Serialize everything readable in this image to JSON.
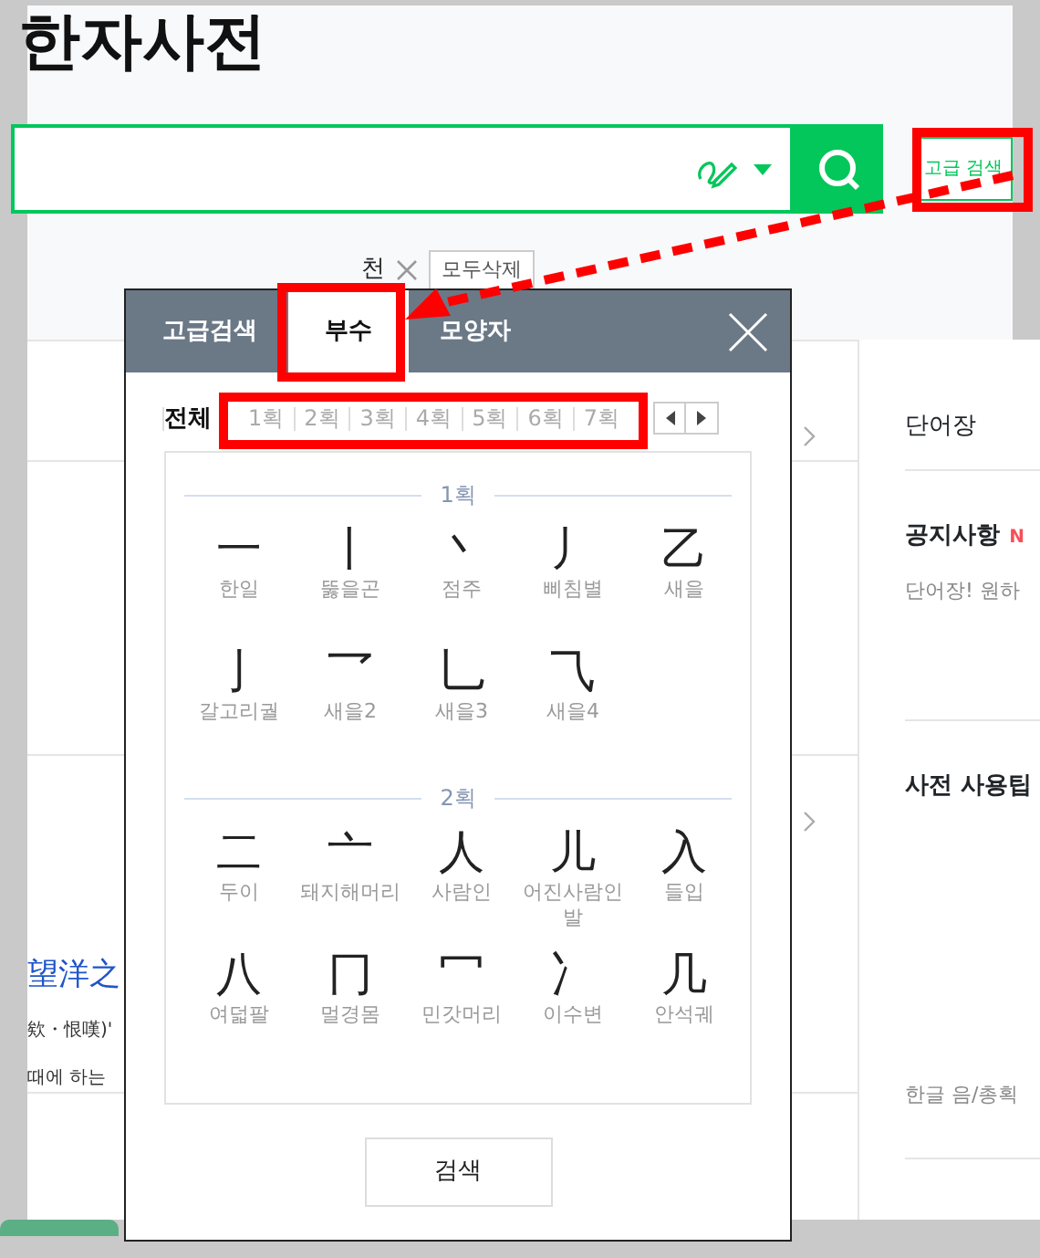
{
  "title": "한자사전",
  "search": {
    "advanced_button": "고급 검색"
  },
  "recent": {
    "items": [
      "천"
    ],
    "clear_all": "모두삭제"
  },
  "left_texts": [
    {
      "kind": "link",
      "text": "望洋之"
    },
    {
      "kind": "plain",
      "text": "欸・恨嘆)'"
    },
    {
      "kind": "plain",
      "text": "때에 하는"
    }
  ],
  "right_panel": {
    "tab": "단어장",
    "notice_title": "공지사항",
    "notice_badge": "N",
    "notice_text": "단어장! 원하",
    "tips_title": "사전 사용팁",
    "tips_text": "한글 음/총획"
  },
  "popup": {
    "tabs": [
      {
        "label": "고급검색",
        "selected": false
      },
      {
        "label": "부수",
        "selected": true
      },
      {
        "label": "모양자",
        "selected": false
      }
    ],
    "filters": [
      {
        "label": "전체",
        "selected": true
      },
      {
        "label": "1획",
        "selected": false
      },
      {
        "label": "2획",
        "selected": false
      },
      {
        "label": "3획",
        "selected": false
      },
      {
        "label": "4획",
        "selected": false
      },
      {
        "label": "5획",
        "selected": false
      },
      {
        "label": "6획",
        "selected": false
      },
      {
        "label": "7획",
        "selected": false
      }
    ],
    "sections": [
      {
        "heading": "1획",
        "items": [
          {
            "glyph": "一",
            "name": "한일"
          },
          {
            "glyph": "丨",
            "name": "뚫을곤"
          },
          {
            "glyph": "丶",
            "name": "점주"
          },
          {
            "glyph": "丿",
            "name": "삐침별"
          },
          {
            "glyph": "乙",
            "name": "새을"
          },
          {
            "glyph": "亅",
            "name": "갈고리궐"
          },
          {
            "glyph": "乛",
            "name": "새을2"
          },
          {
            "glyph": "乚",
            "name": "새을3"
          },
          {
            "glyph": "⺄",
            "name": "새을4"
          }
        ]
      },
      {
        "heading": "2획",
        "items": [
          {
            "glyph": "二",
            "name": "두이"
          },
          {
            "glyph": "亠",
            "name": "돼지해머리"
          },
          {
            "glyph": "人",
            "name": "사람인"
          },
          {
            "glyph": "儿",
            "name": "어진사람인발"
          },
          {
            "glyph": "入",
            "name": "들입"
          },
          {
            "glyph": "八",
            "name": "여덟팔"
          },
          {
            "glyph": "冂",
            "name": "멀경몸"
          },
          {
            "glyph": "冖",
            "name": "민갓머리"
          },
          {
            "glyph": "冫",
            "name": "이수변"
          },
          {
            "glyph": "几",
            "name": "안석궤"
          }
        ]
      }
    ],
    "search_button": "검색"
  }
}
